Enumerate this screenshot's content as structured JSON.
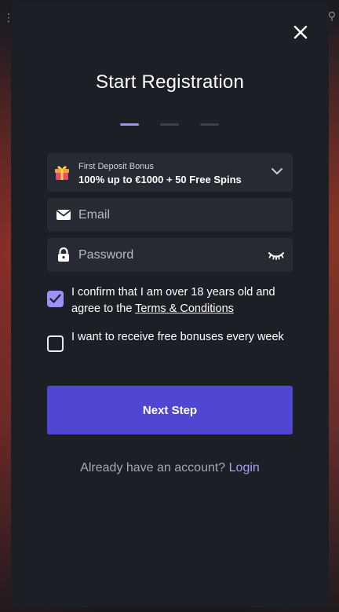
{
  "modal": {
    "title": "Start Registration",
    "steps": [
      {
        "active": true
      },
      {
        "active": false
      },
      {
        "active": false
      }
    ]
  },
  "bonus": {
    "label": "First Deposit Bonus",
    "value": "100% up to €1000 + 50 Free Spins",
    "icon": "gift-icon"
  },
  "form": {
    "email": {
      "placeholder": "Email",
      "value": "",
      "icon": "envelope-icon"
    },
    "password": {
      "placeholder": "Password",
      "value": "",
      "icon": "lock-icon",
      "toggle_icon": "eye-closed-icon"
    }
  },
  "consents": {
    "age": {
      "checked": true,
      "text": "I confirm that I am over 18 years old and agree to the ",
      "link": "Terms & Conditions"
    },
    "bonuses": {
      "checked": false,
      "text": "I want to receive free bonuses every week"
    }
  },
  "actions": {
    "next_label": "Next Step"
  },
  "footer": {
    "prompt": "Already have an account? ",
    "login_label": "Login"
  },
  "colors": {
    "accent": "#4f47d1",
    "link": "#a59ef8",
    "checkbox_on": "#9b92f5",
    "modal_bg": "#1c1f26",
    "field_bg": "#272a33"
  }
}
